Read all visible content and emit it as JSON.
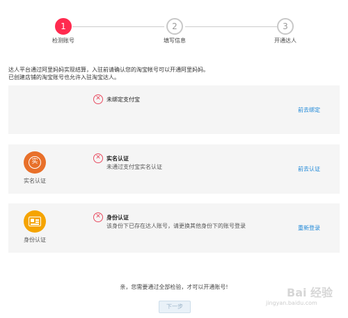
{
  "steps": [
    {
      "number": "1",
      "label": "检测账号",
      "active": true
    },
    {
      "number": "2",
      "label": "填写信息",
      "active": false
    },
    {
      "number": "3",
      "label": "开通达人",
      "active": false
    }
  ],
  "intro": {
    "line1": "达人平台通过阿里妈妈实现结算，入驻前请确认您的淘宝帐号可以开通阿里妈妈。",
    "line2": "已创建店铺的淘宝账号也允许入驻淘宝达人。"
  },
  "checks": [
    {
      "icon": "error-x-icon",
      "title": "未绑定支付宝",
      "description": "",
      "action": "前去绑定"
    },
    {
      "caption": "实名认证",
      "badge_icon": "real-name-icon",
      "badge_glyph": "实",
      "badge_color": "#e8702a",
      "icon": "error-x-icon",
      "title": "实名认证",
      "description": "未通过支付宝实名认证",
      "action": "前去认证"
    },
    {
      "caption": "身份认证",
      "badge_icon": "id-card-icon",
      "badge_color": "#f5a400",
      "icon": "error-x-icon",
      "title": "身份认证",
      "description": "该身份下已存在达人账号，请更换其他身份下的账号登录",
      "action": "重新登录"
    }
  ],
  "footer": {
    "note": "亲，您需要通过全部检验，才可以开通账号!",
    "next_button": "下一步"
  },
  "watermark": {
    "main": "Bai 经验",
    "url": "jingyan.baidu.com"
  },
  "colors": {
    "active_step": "#ff2b4f",
    "link": "#1e88d8",
    "error": "#e84a5f",
    "card_bg": "#f5f5f5"
  }
}
